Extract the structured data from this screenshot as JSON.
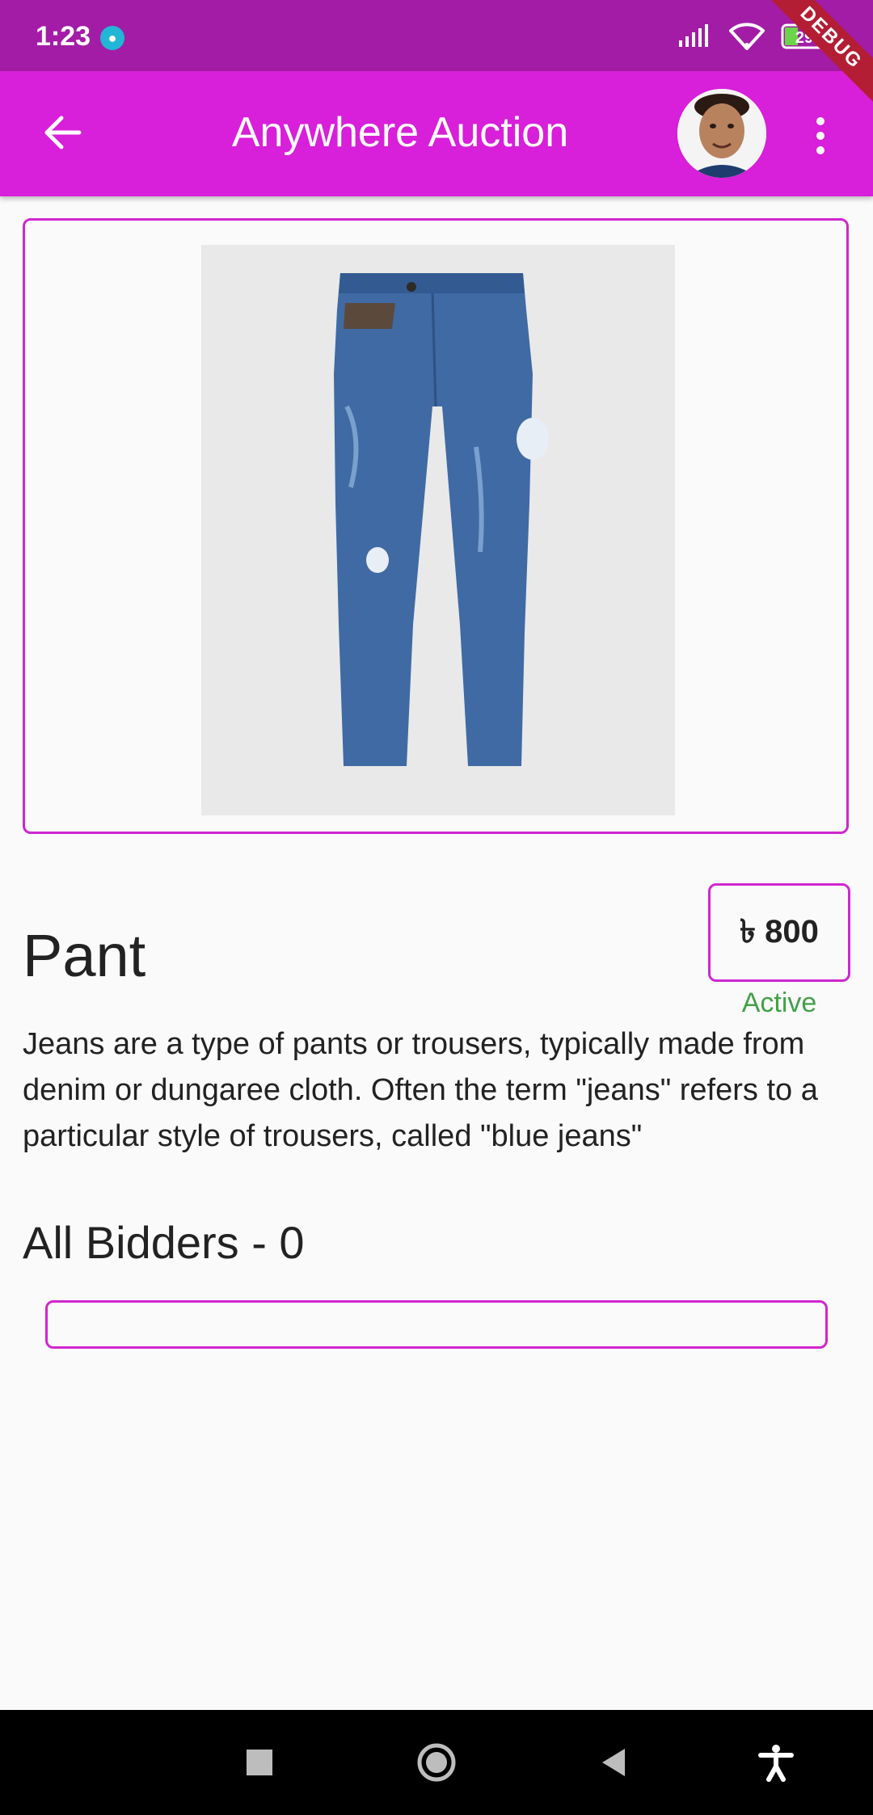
{
  "status_bar": {
    "time": "1:23",
    "battery": "29"
  },
  "debug_banner": "DEBUG",
  "app_bar": {
    "title": "Anywhere Auction"
  },
  "product": {
    "name": "Pant",
    "price": "৳ 800",
    "status": "Active",
    "description": "Jeans are a type of pants or trousers, typically made from denim or dungaree cloth. Often the term \"jeans\" refers to a particular style of trousers, called \"blue jeans\""
  },
  "bidders": {
    "heading": "All Bidders  - 0"
  },
  "colors": {
    "accent": "#d81fd9",
    "status_bar": "#a31ca6",
    "active": "#43a047"
  },
  "icons": [
    "android-icon",
    "signal-icon",
    "wifi-icon",
    "battery-icon",
    "back-arrow-icon",
    "more-vert-icon",
    "square-icon",
    "circle-icon",
    "triangle-icon",
    "accessibility-icon"
  ]
}
